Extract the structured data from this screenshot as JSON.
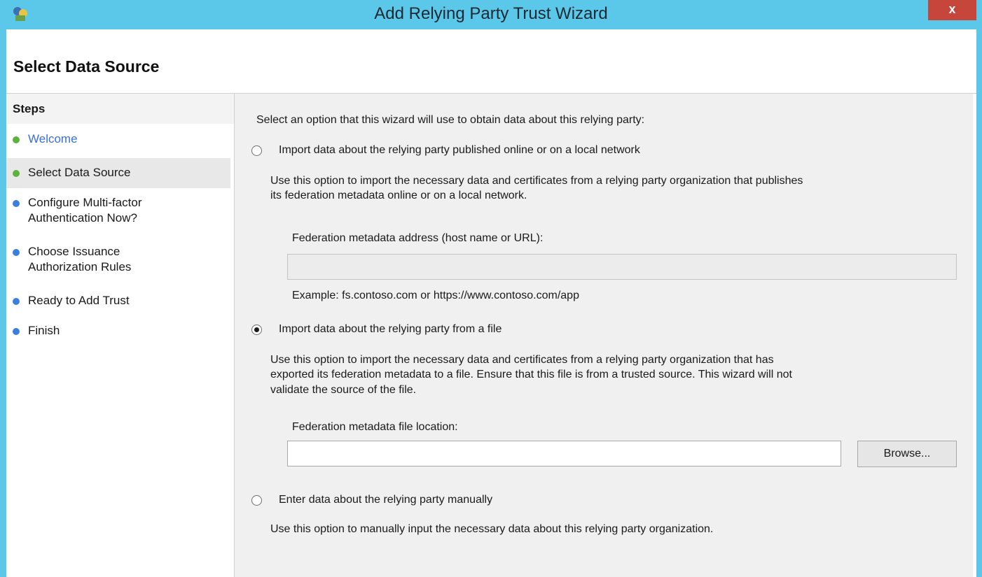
{
  "window": {
    "title": "Add Relying Party Trust Wizard",
    "close_label": "x"
  },
  "page": {
    "title": "Select Data Source"
  },
  "steps": {
    "heading": "Steps",
    "items": [
      {
        "label": "Welcome",
        "state": "completed"
      },
      {
        "label": "Select Data Source",
        "state": "current"
      },
      {
        "label": "Configure Multi-factor Authentication Now?",
        "line1": "Configure Multi-factor",
        "line2": "Authentication Now?",
        "state": "pending"
      },
      {
        "label": "Choose Issuance Authorization Rules",
        "line1": "Choose Issuance",
        "line2": "Authorization Rules",
        "state": "pending"
      },
      {
        "label": "Ready to Add Trust",
        "state": "pending"
      },
      {
        "label": "Finish",
        "state": "pending"
      }
    ],
    "colors": {
      "completed": "#5cb33b",
      "current": "#5cb33b",
      "pending": "#3a7fd9",
      "link": "#3a6fd6"
    }
  },
  "main": {
    "prompt": "Select an option that this wizard will use to obtain data about this relying party:",
    "option_online": {
      "label": "Import data about the relying party published online or on a local network",
      "checked": false,
      "description_line1": "Use this option to import the necessary data and certificates from a relying party organization that publishes",
      "description_line2": "its federation metadata online or on a local network.",
      "field_label": "Federation metadata address (host name or URL):",
      "field_value": "",
      "field_enabled": false,
      "example": "Example: fs.contoso.com or https://www.contoso.com/app"
    },
    "option_file": {
      "label": "Import data about the relying party from a file",
      "checked": true,
      "description_line1": "Use this option to import the necessary data and certificates from a relying party organization that has",
      "description_line2": "exported its federation metadata to a file. Ensure that this file is from a trusted source.  This wizard will not",
      "description_line3": "validate the source of the file.",
      "field_label": "Federation metadata file location:",
      "field_value": "",
      "browse_label": "Browse..."
    },
    "option_manual": {
      "label": "Enter data about the relying party manually",
      "checked": false,
      "description": "Use this option to manually input the necessary data about this relying party organization."
    }
  }
}
